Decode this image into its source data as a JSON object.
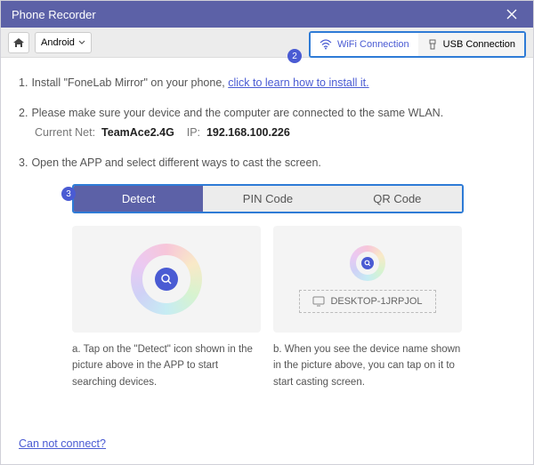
{
  "window": {
    "title": "Phone Recorder"
  },
  "toolbar": {
    "platform": "Android"
  },
  "connection": {
    "wifi": "WiFi Connection",
    "usb": "USB Connection"
  },
  "badges": {
    "b2": "2",
    "b3": "3"
  },
  "steps": {
    "s1": {
      "num": "1.",
      "text": "Install \"FoneLab Mirror\" on your phone, ",
      "link": "click to learn how to install it."
    },
    "s2": {
      "num": "2.",
      "text": "Please make sure your device and the computer are connected to the same WLAN."
    },
    "net": {
      "label1": "Current Net:",
      "val1": "TeamAce2.4G",
      "label2": "IP:",
      "val2": "192.168.100.226"
    },
    "s3": {
      "num": "3.",
      "text": "Open the APP and select different ways to cast the screen."
    }
  },
  "tabs": {
    "detect": "Detect",
    "pin": "PIN Code",
    "qr": "QR Code"
  },
  "cards": {
    "a": {
      "caption": "a. Tap on the \"Detect\" icon shown in the picture above in the APP to start searching devices."
    },
    "b": {
      "device": "DESKTOP-1JRPJOL",
      "caption": "b. When you see the device name shown in the picture above, you can tap on it to start casting screen."
    }
  },
  "footer": {
    "link": "Can not connect?"
  }
}
